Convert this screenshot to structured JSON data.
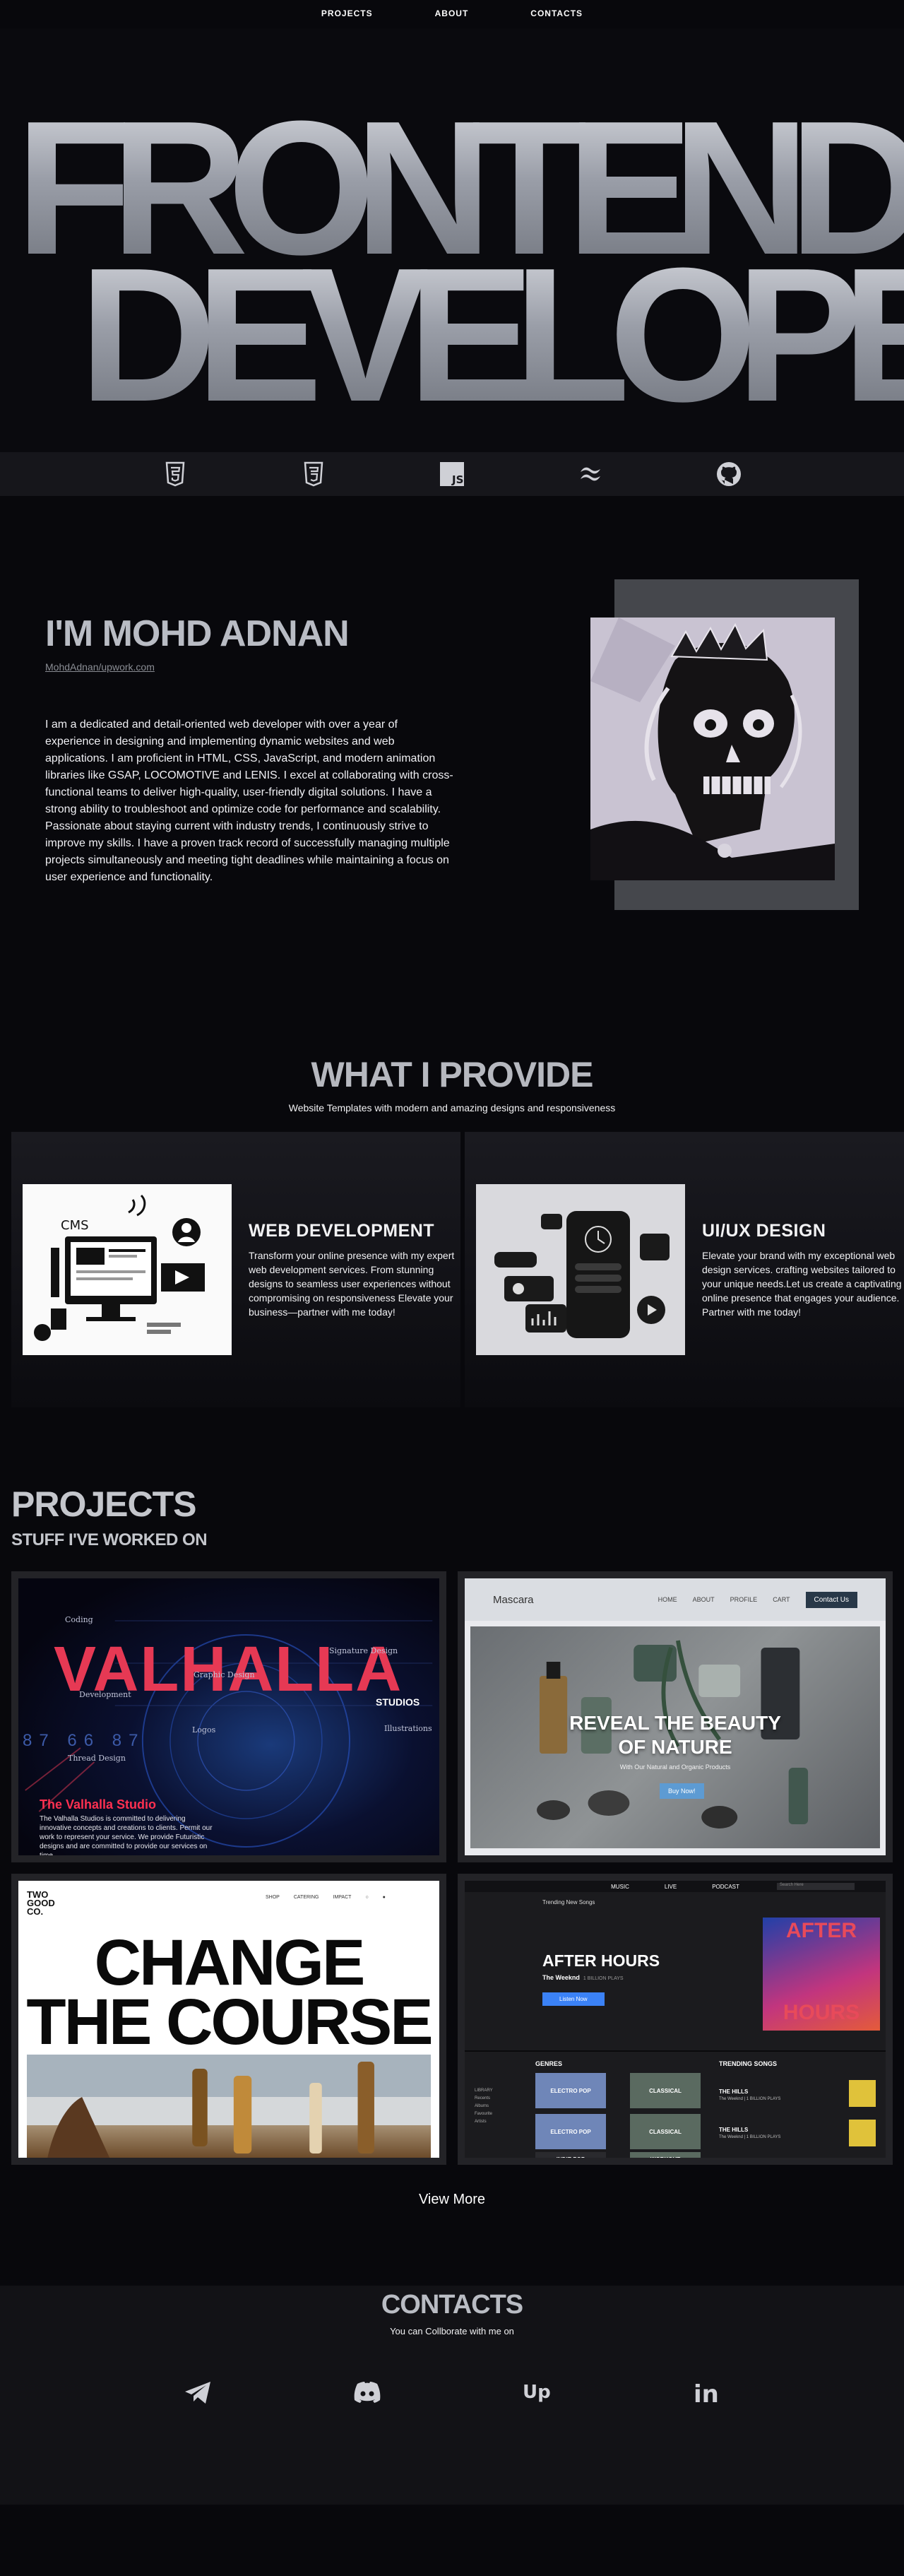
{
  "nav": {
    "items": [
      "PROJECTS",
      "ABOUT",
      "CONTACTS"
    ]
  },
  "hero": {
    "line1": "FRONTEND",
    "line2": "DEVELOPER"
  },
  "skills": {
    "icons": [
      "html5-icon",
      "css3-icon",
      "javascript-icon",
      "tailwind-icon",
      "github-icon"
    ],
    "js_label": "JS"
  },
  "about": {
    "title": "I'M MOHD ADNAN",
    "link": "MohdAdnan/upwork.com",
    "text": "I am a dedicated and detail-oriented web developer with over a year of experience in designing and implementing dynamic websites and web applications. I am proficient in HTML, CSS, JavaScript, and modern animation libraries like GSAP, LOCOMOTIVE and LENIS. I excel at collaborating with cross-functional teams to deliver high-quality, user-friendly digital solutions. I have a strong ability to troubleshoot and optimize code for performance and scalability. Passionate about staying current with industry trends, I continuously strive to improve my skills. I have a proven track record of successfully managing multiple projects simultaneously and meeting tight deadlines while maintaining a focus on user experience and functionality."
  },
  "services": {
    "title": "WHAT I PROVIDE",
    "subtitle": "Website Templates with modern and amazing designs and responsiveness",
    "cards": [
      {
        "title": "WEB DEVELOPMENT",
        "text": "Transform your online presence with my expert web development services. From stunning designs to seamless user experiences without compromising on responsiveness Elevate your business—partner with me today!",
        "img_label": "CMS"
      },
      {
        "title": "UI/UX DESIGN",
        "text": "Elevate your brand with my exceptional web design services. crafting websites tailored to your unique needs.Let us create a captivating online presence that engages your audience. Partner with me today!"
      }
    ]
  },
  "projects": {
    "title": "PROJECTS",
    "subtitle": "STUFF I'VE WORKED ON",
    "valhalla": {
      "title": "VALHALLA",
      "studios": "STUDIOS",
      "tags": [
        "Coding",
        "Signature Design",
        "Graphic Design",
        "Development",
        "Logos",
        "Illustrations",
        "Thread Design"
      ],
      "nums": "87  66  87",
      "studio_name": "The Valhalla Studio",
      "desc": "The Valhalla Studios is committed to delivering innovative concepts and creations to clients. Permit our work to represent your service. We provide Futuristic designs and are committed to provide our services on time."
    },
    "mascara": {
      "logo": "Mascara",
      "menu": [
        "HOME",
        "ABOUT",
        "PROFILE",
        "CART"
      ],
      "cta": "Contact Us",
      "headline_1": "REVEAL THE BEAUTY",
      "headline_2": "OF NATURE",
      "small": "With Our Natural and Organic Products",
      "buy": "Buy Now!"
    },
    "twogood": {
      "logo_1": "TWO",
      "logo_2": "GOOD",
      "logo_3": "CO.",
      "menu": [
        "SHOP",
        "CATERING",
        "IMPACT"
      ],
      "headline_1": "CHANGE",
      "headline_2": "THE COURSE"
    },
    "music": {
      "nav": [
        "MUSIC",
        "LIVE",
        "PODCAST"
      ],
      "search": "Search Here",
      "trending_label": "Trending New Songs",
      "title": "AFTER HOURS",
      "artist": "The Weeknd",
      "artist_sub": "1 BILLION PLAYS",
      "listen": "Listen Now",
      "cover_1": "AFTER",
      "cover_2": "HOURS",
      "genres_label": "GENRES",
      "trending_songs_label": "TRENDING SONGS",
      "genres": [
        "ELECTRO POP",
        "CLASSICAL",
        "ELECTRO POP",
        "CLASSICAL",
        "INDIE POP",
        "WORKOUT"
      ],
      "songs": [
        {
          "title": "THE HILLS",
          "sub": "The Weeknd | 1 BILLION PLAYS"
        },
        {
          "title": "THE HILLS",
          "sub": "The Weeknd | 1 BILLION PLAYS"
        }
      ],
      "library_label": "LIBRARY",
      "library": [
        "Recents",
        "Albums",
        "Favourite",
        "Artists"
      ]
    },
    "view_more": "View More"
  },
  "contacts": {
    "title": "CONTACTS",
    "subtitle": "You can Collborate with me on",
    "icons": [
      "telegram-icon",
      "discord-icon",
      "upwork-icon",
      "linkedin-icon"
    ],
    "upwork_label": "Up",
    "linkedin_label": "in"
  },
  "colors": {
    "background": "#08080c",
    "accent_red": "#e63954",
    "heading_gray": "#b9bcc4"
  }
}
